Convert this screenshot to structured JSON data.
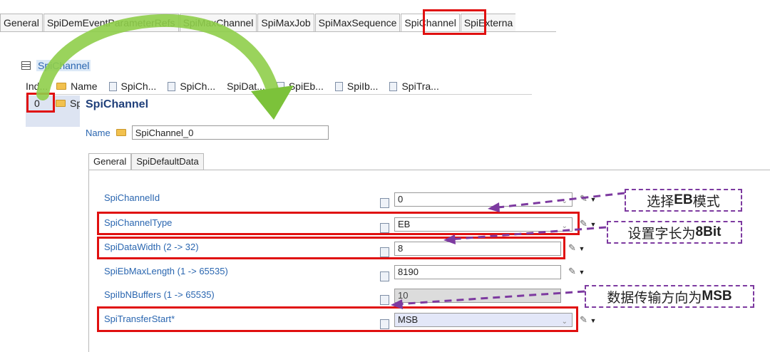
{
  "top_tabs": [
    "General",
    "SpiDemEventParameterRefs",
    "SpiMaxChannel",
    "SpiMaxJob",
    "SpiMaxSequence",
    "SpiChannel",
    "SpiExterna"
  ],
  "table": {
    "title": "SpiChannel",
    "columns": [
      "Ind...",
      "Name",
      "SpiCh...",
      "SpiCh...",
      "SpiDat...",
      "SpiEb...",
      "SpiIb...",
      "SpiTra..."
    ],
    "row0_index": "0",
    "row0_name": "Sp"
  },
  "panel": {
    "title": "SpiChannel",
    "name_label": "Name",
    "name_value": "SpiChannel_0",
    "tabs": [
      "General",
      "SpiDefaultData"
    ],
    "fields": [
      {
        "label": "SpiChannelId",
        "value": "0"
      },
      {
        "label": "SpiChannelType",
        "value": "EB"
      },
      {
        "label": "SpiDataWidth (2 -> 32)",
        "value": "8"
      },
      {
        "label": "SpiEbMaxLength (1 -> 65535)",
        "value": "8190"
      },
      {
        "label": "SpiIbNBuffers (1 -> 65535)",
        "value": "10"
      },
      {
        "label": "SpiTransferStart*",
        "value": "MSB"
      }
    ]
  },
  "annotations": {
    "eb_mode": {
      "text": "选择",
      "bold": "EB",
      "tail": "模式"
    },
    "word_len": {
      "text": "设置字长为",
      "bold": "8Bit",
      "tail": ""
    },
    "msb": {
      "text": "数据传输方向为",
      "bold": "MSB",
      "tail": ""
    }
  },
  "colors": {
    "highlight": "#e01010",
    "annotation": "#7d3aa0",
    "arrow_green": "#7cc23a",
    "label_blue": "#2a66b0"
  }
}
